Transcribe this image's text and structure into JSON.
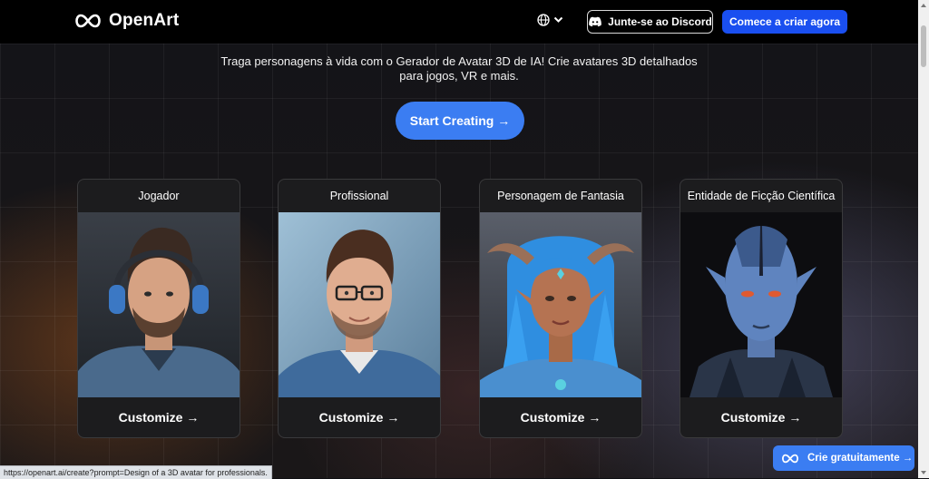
{
  "header": {
    "brand": "OpenArt",
    "language_icon": "globe-icon",
    "discord_label": "Junte-se ao Discord",
    "start_label": "Comece a criar agora"
  },
  "hero": {
    "subtitle_line1": "Traga personagens à vida com o Gerador de Avatar 3D de IA! Crie avatares 3D detalhados",
    "subtitle_line2": "para jogos, VR e mais.",
    "cta_label": "Start Creating →"
  },
  "cards": [
    {
      "title": "Jogador",
      "action": "Customize →"
    },
    {
      "title": "Profissional",
      "action": "Customize →"
    },
    {
      "title": "Personagem de Fantasia",
      "action": "Customize →"
    },
    {
      "title": "Entidade de Ficção Científica",
      "action": "Customize →"
    }
  ],
  "status_bar": {
    "url": "https://openart.ai/create?prompt=Design of a 3D avatar for professionals."
  },
  "floating": {
    "free_label": "Crie gratuitamente →"
  },
  "colors": {
    "primary_blue": "#1a4ff0",
    "cta_blue": "#3b7df2",
    "card_bg": "#1c1c1e"
  }
}
